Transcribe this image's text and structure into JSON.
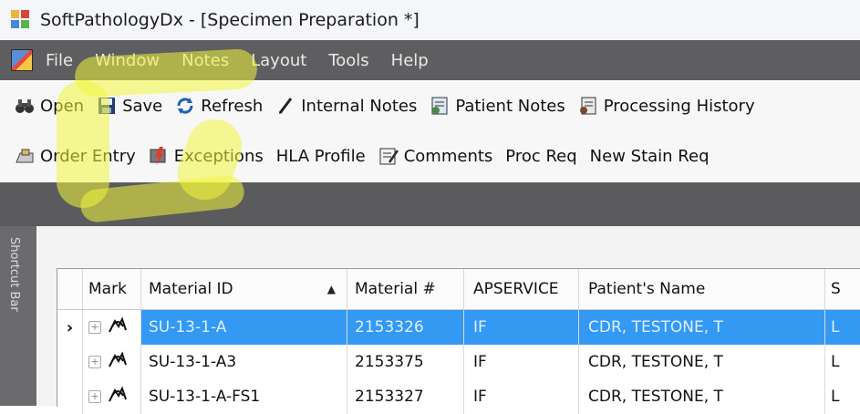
{
  "window": {
    "title": "SoftPathologyDx - [Specimen Preparation *]"
  },
  "menu": {
    "items": [
      {
        "label": "File"
      },
      {
        "label": "Window"
      },
      {
        "label": "Notes"
      },
      {
        "label": "Layout"
      },
      {
        "label": "Tools"
      },
      {
        "label": "Help"
      }
    ]
  },
  "toolbar1": {
    "open": "Open",
    "save": "Save",
    "refresh": "Refresh",
    "internal_notes": "Internal Notes",
    "patient_notes": "Patient Notes",
    "processing_history": "Processing History"
  },
  "toolbar2": {
    "order_entry": "Order Entry",
    "exceptions": "Exceptions",
    "hla_profile": "HLA Profile",
    "comments": "Comments",
    "proc_req": "Proc Req",
    "new_stain_req": "New Stain Req"
  },
  "shortcut_bar": {
    "label": "Shortcut Bar"
  },
  "grid": {
    "columns": [
      "Mark",
      "Material ID",
      "Material #",
      "APSERVICE",
      "Patient's Name",
      "S"
    ],
    "sort_indicator": "▲",
    "rows": [
      {
        "material_id": "SU-13-1-A",
        "material_num": "2153326",
        "apservice": "IF",
        "patient_name": "CDR, TESTONE, T",
        "s": "L",
        "selected": true
      },
      {
        "material_id": "SU-13-1-A3",
        "material_num": "2153375",
        "apservice": "IF",
        "patient_name": "CDR, TESTONE, T",
        "s": "L",
        "selected": false
      },
      {
        "material_id": "SU-13-1-A-FS1",
        "material_num": "2153327",
        "apservice": "IF",
        "patient_name": "CDR, TESTONE, T",
        "s": "L",
        "selected": false
      }
    ]
  },
  "colors": {
    "menubar_bg": "#5e5e60",
    "selection": "#3399f3",
    "highlighter": "#f0f53c"
  }
}
